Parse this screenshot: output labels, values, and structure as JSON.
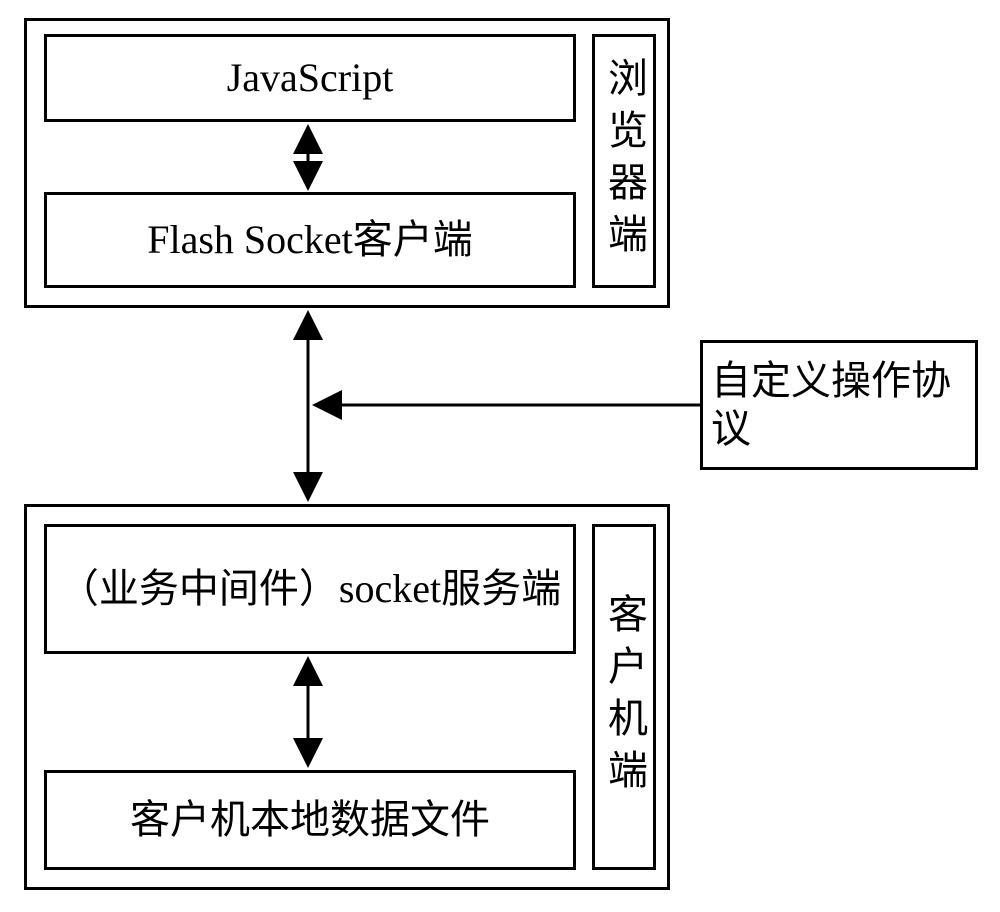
{
  "browser": {
    "label": "浏览器端",
    "js": "JavaScript",
    "flash": "Flash Socket客户端"
  },
  "client": {
    "label": "客户机端",
    "middleware": "（业务中间件）socket服务端",
    "localfile": "客户机本地数据文件"
  },
  "protocol": "自定义操作协议"
}
